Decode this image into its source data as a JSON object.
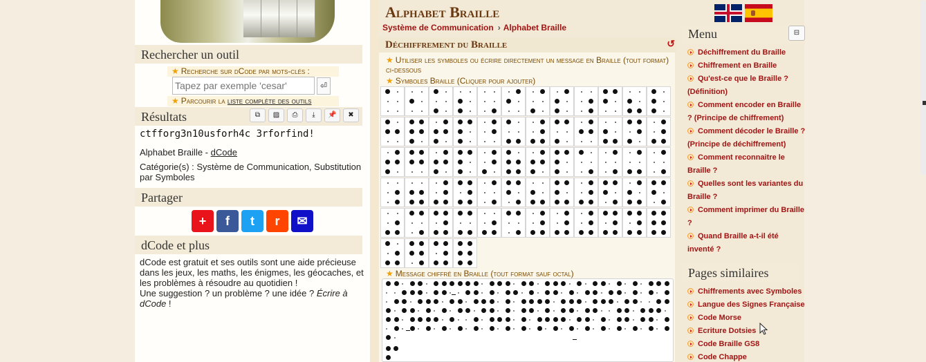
{
  "left": {
    "search_title": "Rechercher un outil",
    "search_keywords_label": "Recherche sur dCode par mots-clés :",
    "search_placeholder": "Tapez par exemple 'cesar'",
    "search_button": "⏎",
    "browse_prefix": "Parcourir la",
    "browse_link": "liste complète des outils",
    "results_title": "Résultats",
    "tool_buttons": [
      {
        "icon": "copy-icon",
        "glyph": "⧉"
      },
      {
        "icon": "screenshot-icon",
        "glyph": "▨"
      },
      {
        "icon": "print-icon",
        "glyph": "⎙"
      },
      {
        "icon": "download-icon",
        "glyph": "⤓"
      },
      {
        "icon": "pin-icon",
        "glyph": "📌"
      },
      {
        "icon": "close-icon",
        "glyph": "✖"
      }
    ],
    "result_text": "ctfforg3n10usforh4c 3rforfind!",
    "result_source": "Alphabet Braille - ",
    "result_source_link": "dCode",
    "categories": "Catégorie(s) : Système de Communication, Substitution par Symboles",
    "share_title": "Partager",
    "share_buttons": [
      {
        "icon": "addthis-icon",
        "glyph": "+",
        "color": "#e8131b"
      },
      {
        "icon": "facebook-icon",
        "glyph": "f",
        "color": "#3b5998"
      },
      {
        "icon": "twitter-icon",
        "glyph": "t",
        "color": "#1da1f2"
      },
      {
        "icon": "reddit-icon",
        "glyph": "r",
        "color": "#ff4500"
      },
      {
        "icon": "email-icon",
        "glyph": "✉",
        "color": "#1010c8"
      }
    ],
    "more_title": "dCode et plus",
    "more_text": "dCode est gratuit et ses outils sont une aide précieuse dans les jeux, les maths, les énigmes, les géocaches, et les problèmes à résoudre au quotidien !",
    "suggestion_text": "Une suggestion ? un problème ? une idée ? ",
    "suggestion_link": "Écrire à dCode",
    "suggestion_end": " !"
  },
  "main": {
    "title": "Alphabet Braille",
    "breadcrumb": [
      "Système de Communication",
      "Alphabet Braille"
    ],
    "section_title": "Déchiffrement du Braille",
    "instruction": "Utiliser les symboles ou écrire directement un message en Braille (tout format) ci-dessous",
    "symbols_label": "Symboles Braille (Cliquer pour ajouter)",
    "message_label": "Message chiffré en Braille (tout format sauf octal)",
    "braille_symbols": [
      [
        1,
        0,
        0,
        0,
        0,
        0
      ],
      [
        0,
        1,
        0,
        0,
        0,
        0
      ],
      [
        1,
        0,
        1,
        0,
        0,
        0
      ],
      [
        0,
        1,
        1,
        0,
        0,
        0
      ],
      [
        0,
        0,
        0,
        0,
        0,
        1
      ],
      [
        0,
        1,
        0,
        1,
        0,
        0
      ],
      [
        0,
        0,
        1,
        1,
        0,
        0
      ],
      [
        0,
        1,
        1,
        1,
        0,
        0
      ],
      [
        0,
        0,
        0,
        0,
        1,
        1
      ],
      [
        1,
        1,
        0,
        1,
        0,
        0
      ],
      [
        0,
        1,
        1,
        0,
        0,
        1
      ],
      [
        1,
        1,
        1,
        0,
        0,
        0
      ],
      [
        1,
        1,
        0,
        0,
        1,
        0
      ],
      [
        1,
        1,
        1,
        1,
        1,
        0
      ],
      [
        0,
        1,
        1,
        1,
        1,
        0
      ],
      [
        1,
        1,
        1,
        1,
        0,
        0
      ],
      [
        0,
        0,
        0,
        1,
        1,
        0
      ],
      [
        1,
        0,
        1,
        0,
        0,
        1
      ],
      [
        0,
        0,
        1,
        1,
        1,
        1
      ],
      [
        1,
        0,
        1,
        1,
        0,
        0
      ],
      [
        0,
        1,
        0,
        1,
        1,
        0
      ],
      [
        0,
        1,
        1,
        0,
        0,
        1
      ],
      [
        1,
        0,
        1,
        1,
        1,
        0
      ],
      [
        0,
        0,
        1,
        1,
        1,
        1
      ],
      [
        0,
        1,
        1,
        1,
        1,
        0
      ],
      [
        1,
        1,
        0,
        1,
        1,
        0
      ],
      [
        0,
        1,
        1,
        1,
        1,
        0
      ],
      [
        1,
        1,
        1,
        1,
        0,
        0
      ],
      [
        0,
        0,
        1,
        1,
        1,
        0
      ],
      [
        1,
        1,
        1,
        0,
        1,
        1
      ],
      [
        0,
        1,
        1,
        1,
        1,
        0
      ],
      [
        1,
        1,
        1,
        1,
        0,
        0
      ],
      [
        1,
        0,
        0,
        0,
        0,
        1
      ],
      [
        0,
        0,
        0,
        1,
        0,
        1
      ],
      [
        0,
        0,
        1,
        1,
        0,
        1
      ],
      [
        0,
        0,
        0,
        1,
        0,
        1
      ],
      [
        0,
        0,
        0,
        0,
        1,
        1
      ],
      [
        0,
        1,
        1,
        0,
        1,
        1
      ],
      [
        0,
        0,
        1,
        1,
        1,
        1
      ],
      [
        1,
        0,
        1,
        1,
        1,
        1
      ],
      [
        0,
        0,
        0,
        1,
        0,
        1
      ],
      [
        1,
        1,
        0,
        1,
        0,
        1
      ],
      [
        0,
        1,
        1,
        0,
        0,
        1
      ],
      [
        1,
        1,
        1,
        1,
        0,
        1
      ],
      [
        0,
        0,
        1,
        1,
        1,
        1
      ],
      [
        1,
        1,
        0,
        1,
        0,
        1
      ],
      [
        0,
        1,
        1,
        1,
        0,
        1
      ],
      [
        1,
        1,
        0,
        1,
        0,
        1
      ],
      [
        0,
        0,
        1,
        0,
        1,
        1
      ],
      [
        1,
        0,
        0,
        1,
        0,
        1
      ],
      [
        1,
        0,
        1,
        1,
        1,
        1
      ],
      [
        1,
        0,
        1,
        1,
        0,
        1
      ],
      [
        0,
        0,
        1,
        0,
        1,
        1
      ],
      [
        1,
        0,
        0,
        1,
        0,
        1
      ],
      [
        0,
        0,
        1,
        1,
        1,
        1
      ],
      [
        0,
        0,
        1,
        1,
        1,
        1
      ],
      [
        0,
        0,
        1,
        1,
        1,
        1
      ],
      [
        1,
        0,
        1,
        1,
        1,
        1
      ],
      [
        1,
        0,
        1,
        1,
        1,
        1
      ],
      [
        1,
        1,
        1,
        1,
        1,
        1
      ],
      [
        1,
        0,
        1,
        0,
        1,
        1
      ],
      [
        1,
        1,
        0,
        1,
        1,
        1
      ],
      [
        1,
        0,
        1,
        1,
        1,
        1
      ],
      [
        1,
        1,
        1,
        1,
        1,
        1
      ]
    ]
  },
  "right": {
    "menu_title": "Menu",
    "menu_toggle": "⊟",
    "menu_items": [
      "Déchiffrement du Braille",
      "Chiffrement en Braille",
      "Qu'est-ce que le Braille ? (Définition)",
      "Comment encoder en Braille ? (Principe de chiffrement)",
      "Comment décoder le Braille ? (Principe de déchiffrement)",
      "Comment reconnaitre le Braille ?",
      "Quelles sont les variantes du Braille ?",
      "Comment imprimer du Braille ?",
      "Quand Braille a-t-il été inventé ?"
    ],
    "similar_title": "Pages similaires",
    "similar_items": [
      "Chiffrements avec Symboles",
      "Langue des Signes Française",
      "Code Morse",
      "Ecriture Dotsies",
      "Code Braille GS8",
      "Code Chappe"
    ]
  },
  "colors": {
    "link_red": "#a01414",
    "title_brown": "#6b3a12",
    "star_orange": "#f0a000"
  }
}
